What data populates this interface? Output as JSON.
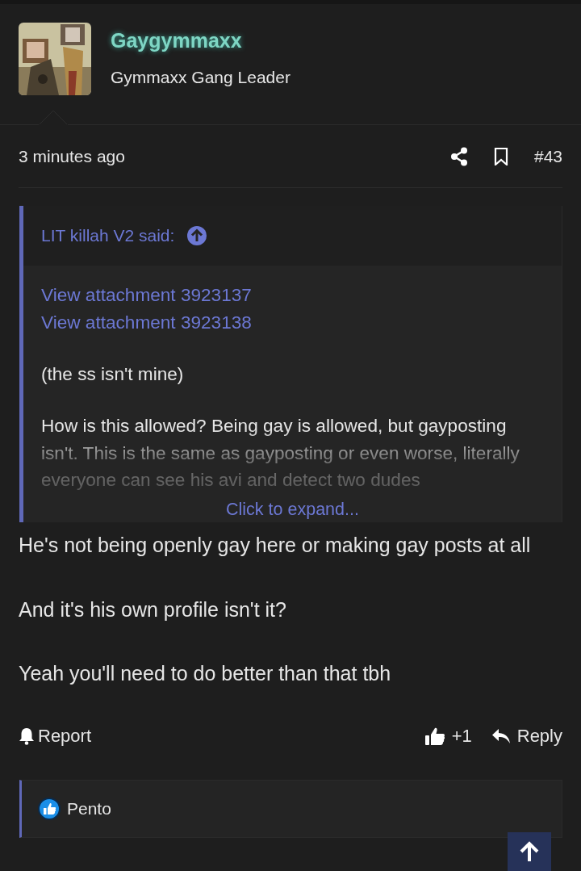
{
  "author": {
    "name": "Gaygymmaxx",
    "title": "Gymmaxx Gang Leader"
  },
  "post": {
    "time": "3 minutes ago",
    "number": "#43"
  },
  "quote": {
    "author": "LIT killah V2 said:",
    "links": [
      "View attachment 3923137",
      "View attachment 3923138"
    ],
    "paragraphs": [
      "(the ss isn't mine)",
      "How is this allowed? Being gay is allowed, but gayposting isn't. This is the same as gayposting or even worse, literally everyone can see his avi and detect two dudes"
    ],
    "expand": "Click to expand..."
  },
  "message": [
    "He's not being openly gay here or making gay posts at all",
    "And it's his own profile isn't it?",
    "Yeah you'll need to do better than that tbh"
  ],
  "actions": {
    "report": "Report",
    "reactions": "+1",
    "reply": "Reply"
  },
  "reactions_bar": {
    "users": [
      "Pento"
    ]
  }
}
